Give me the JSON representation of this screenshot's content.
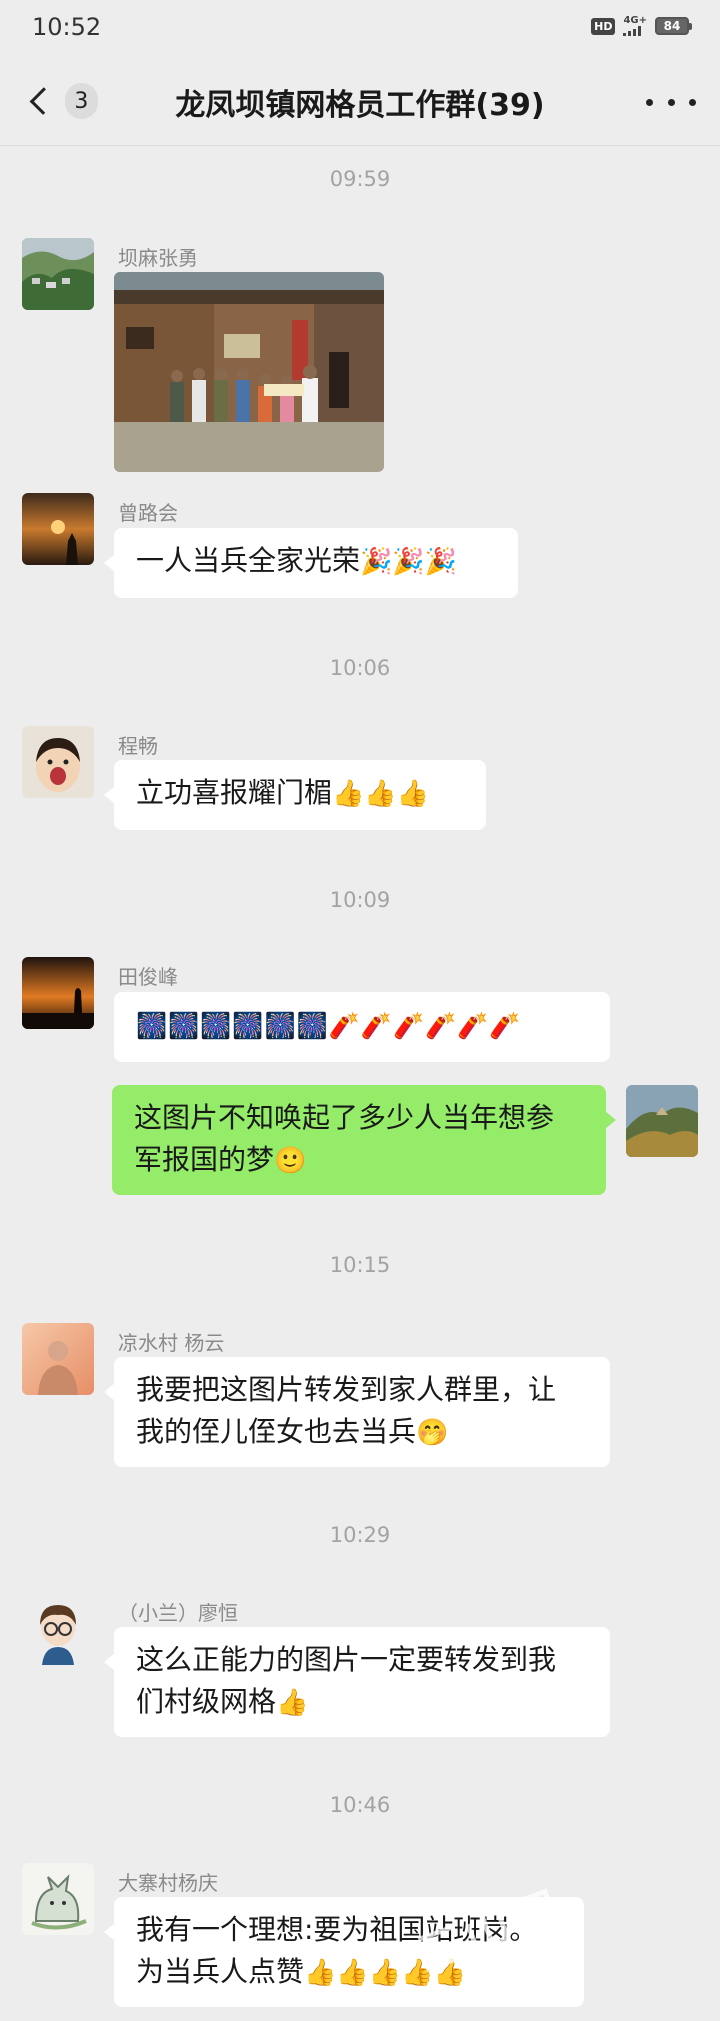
{
  "status_bar": {
    "time": "10:52",
    "hd": "HD",
    "network": "4G+",
    "battery": "84"
  },
  "header": {
    "unread_count": "3",
    "title": "龙凤坝镇网格员工作群(39)"
  },
  "timestamps": [
    "09:59",
    "10:06",
    "10:09",
    "10:15",
    "10:29",
    "10:46"
  ],
  "messages": [
    {
      "sender": "坝麻张勇",
      "type": "image"
    },
    {
      "sender": "曾路会",
      "text": "一人当兵全家光荣",
      "emoji": "🎉🎉🎉"
    },
    {
      "sender": "程畅",
      "text": "立功喜报耀门楣",
      "emoji": "👍👍👍"
    },
    {
      "sender": "田俊峰",
      "text": "",
      "emoji": "🎆🎆🎆🎆🎆🎆🧨🧨🧨🧨🧨🧨"
    },
    {
      "sender": "me",
      "line1": "这图片不知唤起了多少人当年想参",
      "line2": "军报国的梦",
      "emoji": "🙂"
    },
    {
      "sender": "凉水村 杨云",
      "line1": "我要把这图片转发到家人群里，让",
      "line2": "我的侄儿侄女也去当兵",
      "emoji": "🤭"
    },
    {
      "sender": "（小兰）廖恒",
      "line1": "这么正能力的图片一定要转发到我",
      "line2": "们村级网格",
      "emoji": "👍"
    },
    {
      "sender": "大寨村杨庆",
      "line1": "我有一个理想:要为祖国站班岗。",
      "line2": "为当兵人点赞",
      "emoji": "👍👍👍👍👍"
    }
  ],
  "watermark": "三山网",
  "colors": {
    "background": "#ededed",
    "bubble_other": "#ffffff",
    "bubble_self": "#95ec69",
    "timestamp": "#a3a3a3",
    "sender_name": "#8a8a8a"
  }
}
